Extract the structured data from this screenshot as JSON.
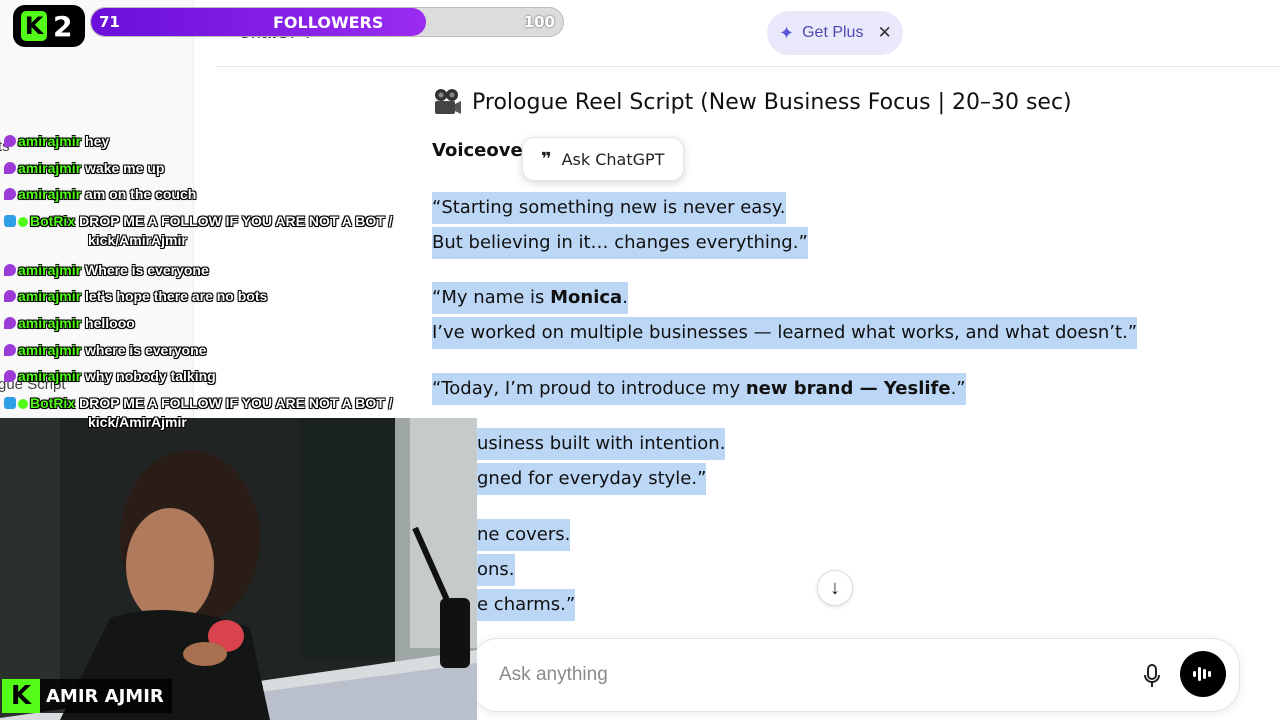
{
  "window": {
    "title_fragment": "ChatGPT",
    "get_plus": "Get Plus"
  },
  "sidebar": {
    "fragment_a": "ts",
    "fragment_b": "gue Script"
  },
  "document": {
    "heading": "Prologue Reel Script (New Business Focus | 20–30 sec)",
    "voiceover": "Voiceover",
    "ask_chatgpt": "Ask ChatGPT",
    "lines": [
      {
        "text": "“Starting something new is never easy."
      },
      {
        "text": "But believing in it… changes everything.”"
      },
      {
        "pre": "“My name is ",
        "bold": "Monica",
        "post": "."
      },
      {
        "text": "I’ve worked on multiple businesses — learned what works, and what doesn’t.”"
      },
      {
        "pre": "“Today, I’m proud to introduce my ",
        "bold": "new brand — Yeslife",
        "post": ".”"
      },
      {
        "text": "usiness built with intention."
      },
      {
        "text": "gned for everyday style.”"
      },
      {
        "text": "ne covers."
      },
      {
        "text": "ons."
      },
      {
        "text": "e charms.”"
      }
    ]
  },
  "composer": {
    "placeholder": "Ask anything"
  },
  "overlay": {
    "kick_level": "2",
    "followers": {
      "label": "FOLLOWERS",
      "current": "71",
      "goal": "100",
      "progress": 0.71
    },
    "chat": [
      {
        "badge": "purple",
        "user": "amirajmir",
        "text": "hey"
      },
      {
        "badge": "purple",
        "user": "amirajmir",
        "text": "wake me up"
      },
      {
        "badge": "purple",
        "user": "amirajmir",
        "text": "am on the couch"
      },
      {
        "badge": "bot",
        "user": "BotRix",
        "text": "DROP ME A FOLLOW IF YOU ARE NOT A BOT /",
        "cont": "kick/AmirAjmir"
      },
      {
        "badge": "purple",
        "user": "amirajmir",
        "text": "Where is everyone"
      },
      {
        "badge": "purple",
        "user": "amirajmir",
        "text": "let's hope there are no bots"
      },
      {
        "badge": "purple",
        "user": "amirajmir",
        "text": "hellooo"
      },
      {
        "badge": "purple",
        "user": "amirajmir",
        "text": "where is everyone"
      },
      {
        "badge": "purple",
        "user": "amirajmir",
        "text": "why nobody talking"
      },
      {
        "badge": "bot",
        "user": "BotRix",
        "text": "DROP ME A FOLLOW IF YOU ARE NOT A BOT /",
        "cont": "kick/AmirAjmir"
      }
    ],
    "streamer_name": "AMIR AJMIR"
  },
  "colors": {
    "selection": "#bcd7f6",
    "kick_green": "#53fc18",
    "goal_purple": "#7a16e6",
    "plus_bg": "#eae9fb"
  }
}
